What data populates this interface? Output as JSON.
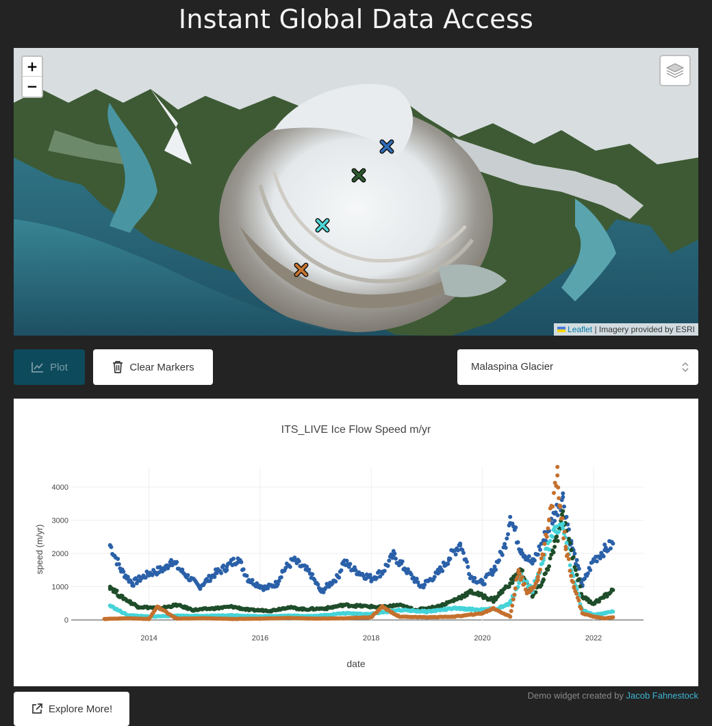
{
  "page": {
    "title": "Instant Global Data Access"
  },
  "map": {
    "zoom_in": "+",
    "zoom_out": "−",
    "attribution_link": "Leaflet",
    "attribution_text": "| Imagery provided by ESRI",
    "markers": [
      {
        "name": "marker-blue",
        "color": "#2f6db8"
      },
      {
        "name": "marker-dark-green",
        "color": "#2d5a2f"
      },
      {
        "name": "marker-cyan",
        "color": "#4fd6d6"
      },
      {
        "name": "marker-orange",
        "color": "#c8742f"
      }
    ]
  },
  "controls": {
    "plot_label": "Plot",
    "clear_label": "Clear Markers",
    "select_value": "Malaspina Glacier"
  },
  "chart_data": {
    "type": "scatter",
    "title": "ITS_LIVE Ice Flow Speed m/yr",
    "xlabel": "date",
    "ylabel": "speed (m/yr)",
    "xlim": [
      2012.6,
      2022.9
    ],
    "ylim": [
      -100,
      4600
    ],
    "x_ticks": [
      "2014",
      "2016",
      "2018",
      "2020",
      "2022"
    ],
    "y_ticks": [
      "0",
      "1000",
      "2000",
      "3000",
      "4000"
    ],
    "series": [
      {
        "color": "#2a60a8",
        "x": [
          2013.3,
          2013.5,
          2013.7,
          2014.0,
          2014.3,
          2014.4,
          2014.6,
          2014.9,
          2015.2,
          2015.4,
          2015.6,
          2015.8,
          2016.1,
          2016.3,
          2016.4,
          2016.6,
          2016.9,
          2017.1,
          2017.4,
          2017.5,
          2017.7,
          2018.0,
          2018.2,
          2018.4,
          2018.6,
          2018.9,
          2019.2,
          2019.4,
          2019.6,
          2019.8,
          2020.0,
          2020.2,
          2020.4,
          2020.5,
          2020.7,
          2020.9,
          2021.1,
          2021.3,
          2021.45,
          2021.6,
          2021.8,
          2022.0,
          2022.2,
          2022.35
        ],
        "y": [
          2250,
          1500,
          1100,
          1400,
          1550,
          1800,
          1450,
          1000,
          1400,
          1600,
          1850,
          1200,
          950,
          1100,
          1450,
          1800,
          1400,
          850,
          1300,
          1750,
          1500,
          1250,
          1450,
          1950,
          1550,
          1000,
          1400,
          1850,
          2300,
          1300,
          1100,
          1500,
          2200,
          3100,
          2100,
          1700,
          2400,
          3200,
          3700,
          2300,
          1050,
          1800,
          2100,
          2300
        ]
      },
      {
        "color": "#1f4d2a",
        "x": [
          2013.3,
          2013.5,
          2013.8,
          2014.2,
          2014.5,
          2014.8,
          2015.2,
          2015.5,
          2015.8,
          2016.2,
          2016.5,
          2016.8,
          2017.2,
          2017.5,
          2017.8,
          2018.2,
          2018.5,
          2018.8,
          2019.2,
          2019.5,
          2019.8,
          2020.2,
          2020.5,
          2020.7,
          2020.9,
          2021.1,
          2021.3,
          2021.45,
          2021.6,
          2021.8,
          2022.0,
          2022.2,
          2022.35
        ],
        "y": [
          1000,
          700,
          400,
          350,
          450,
          300,
          350,
          400,
          300,
          280,
          380,
          320,
          350,
          450,
          420,
          380,
          450,
          300,
          400,
          600,
          850,
          600,
          1100,
          1500,
          700,
          1200,
          2200,
          3100,
          2100,
          700,
          500,
          700,
          900
        ]
      },
      {
        "color": "#45d3d8",
        "x": [
          2013.3,
          2013.6,
          2014.0,
          2014.5,
          2015.0,
          2015.5,
          2016.0,
          2016.5,
          2017.0,
          2017.5,
          2018.0,
          2018.5,
          2019.0,
          2019.5,
          2020.0,
          2020.3,
          2020.5,
          2020.7,
          2020.9,
          2021.1,
          2021.3,
          2021.45,
          2021.6,
          2021.8,
          2022.0,
          2022.2,
          2022.35
        ],
        "y": [
          430,
          150,
          100,
          130,
          120,
          140,
          110,
          130,
          120,
          200,
          180,
          300,
          250,
          350,
          300,
          350,
          500,
          1300,
          900,
          1800,
          2700,
          2900,
          1500,
          300,
          150,
          200,
          250
        ]
      },
      {
        "color": "#c4702e",
        "x": [
          2013.2,
          2013.6,
          2014.0,
          2014.15,
          2014.5,
          2015.0,
          2015.5,
          2016.0,
          2016.5,
          2017.0,
          2017.5,
          2018.0,
          2018.2,
          2018.5,
          2019.0,
          2019.5,
          2020.0,
          2020.2,
          2020.5,
          2020.65,
          2020.8,
          2021.0,
          2021.2,
          2021.35,
          2021.4,
          2021.5,
          2021.65,
          2021.8,
          2022.0,
          2022.2,
          2022.35
        ],
        "y": [
          30,
          50,
          30,
          400,
          40,
          50,
          30,
          40,
          60,
          40,
          50,
          80,
          400,
          100,
          80,
          100,
          200,
          350,
          100,
          1500,
          800,
          1200,
          3000,
          4350,
          3400,
          2200,
          1000,
          200,
          100,
          50,
          80
        ]
      }
    ]
  },
  "footer": {
    "explore_label": "Explore More!",
    "credit_prefix": "Demo widget created by",
    "credit_author": "Jacob Fahnestock"
  }
}
